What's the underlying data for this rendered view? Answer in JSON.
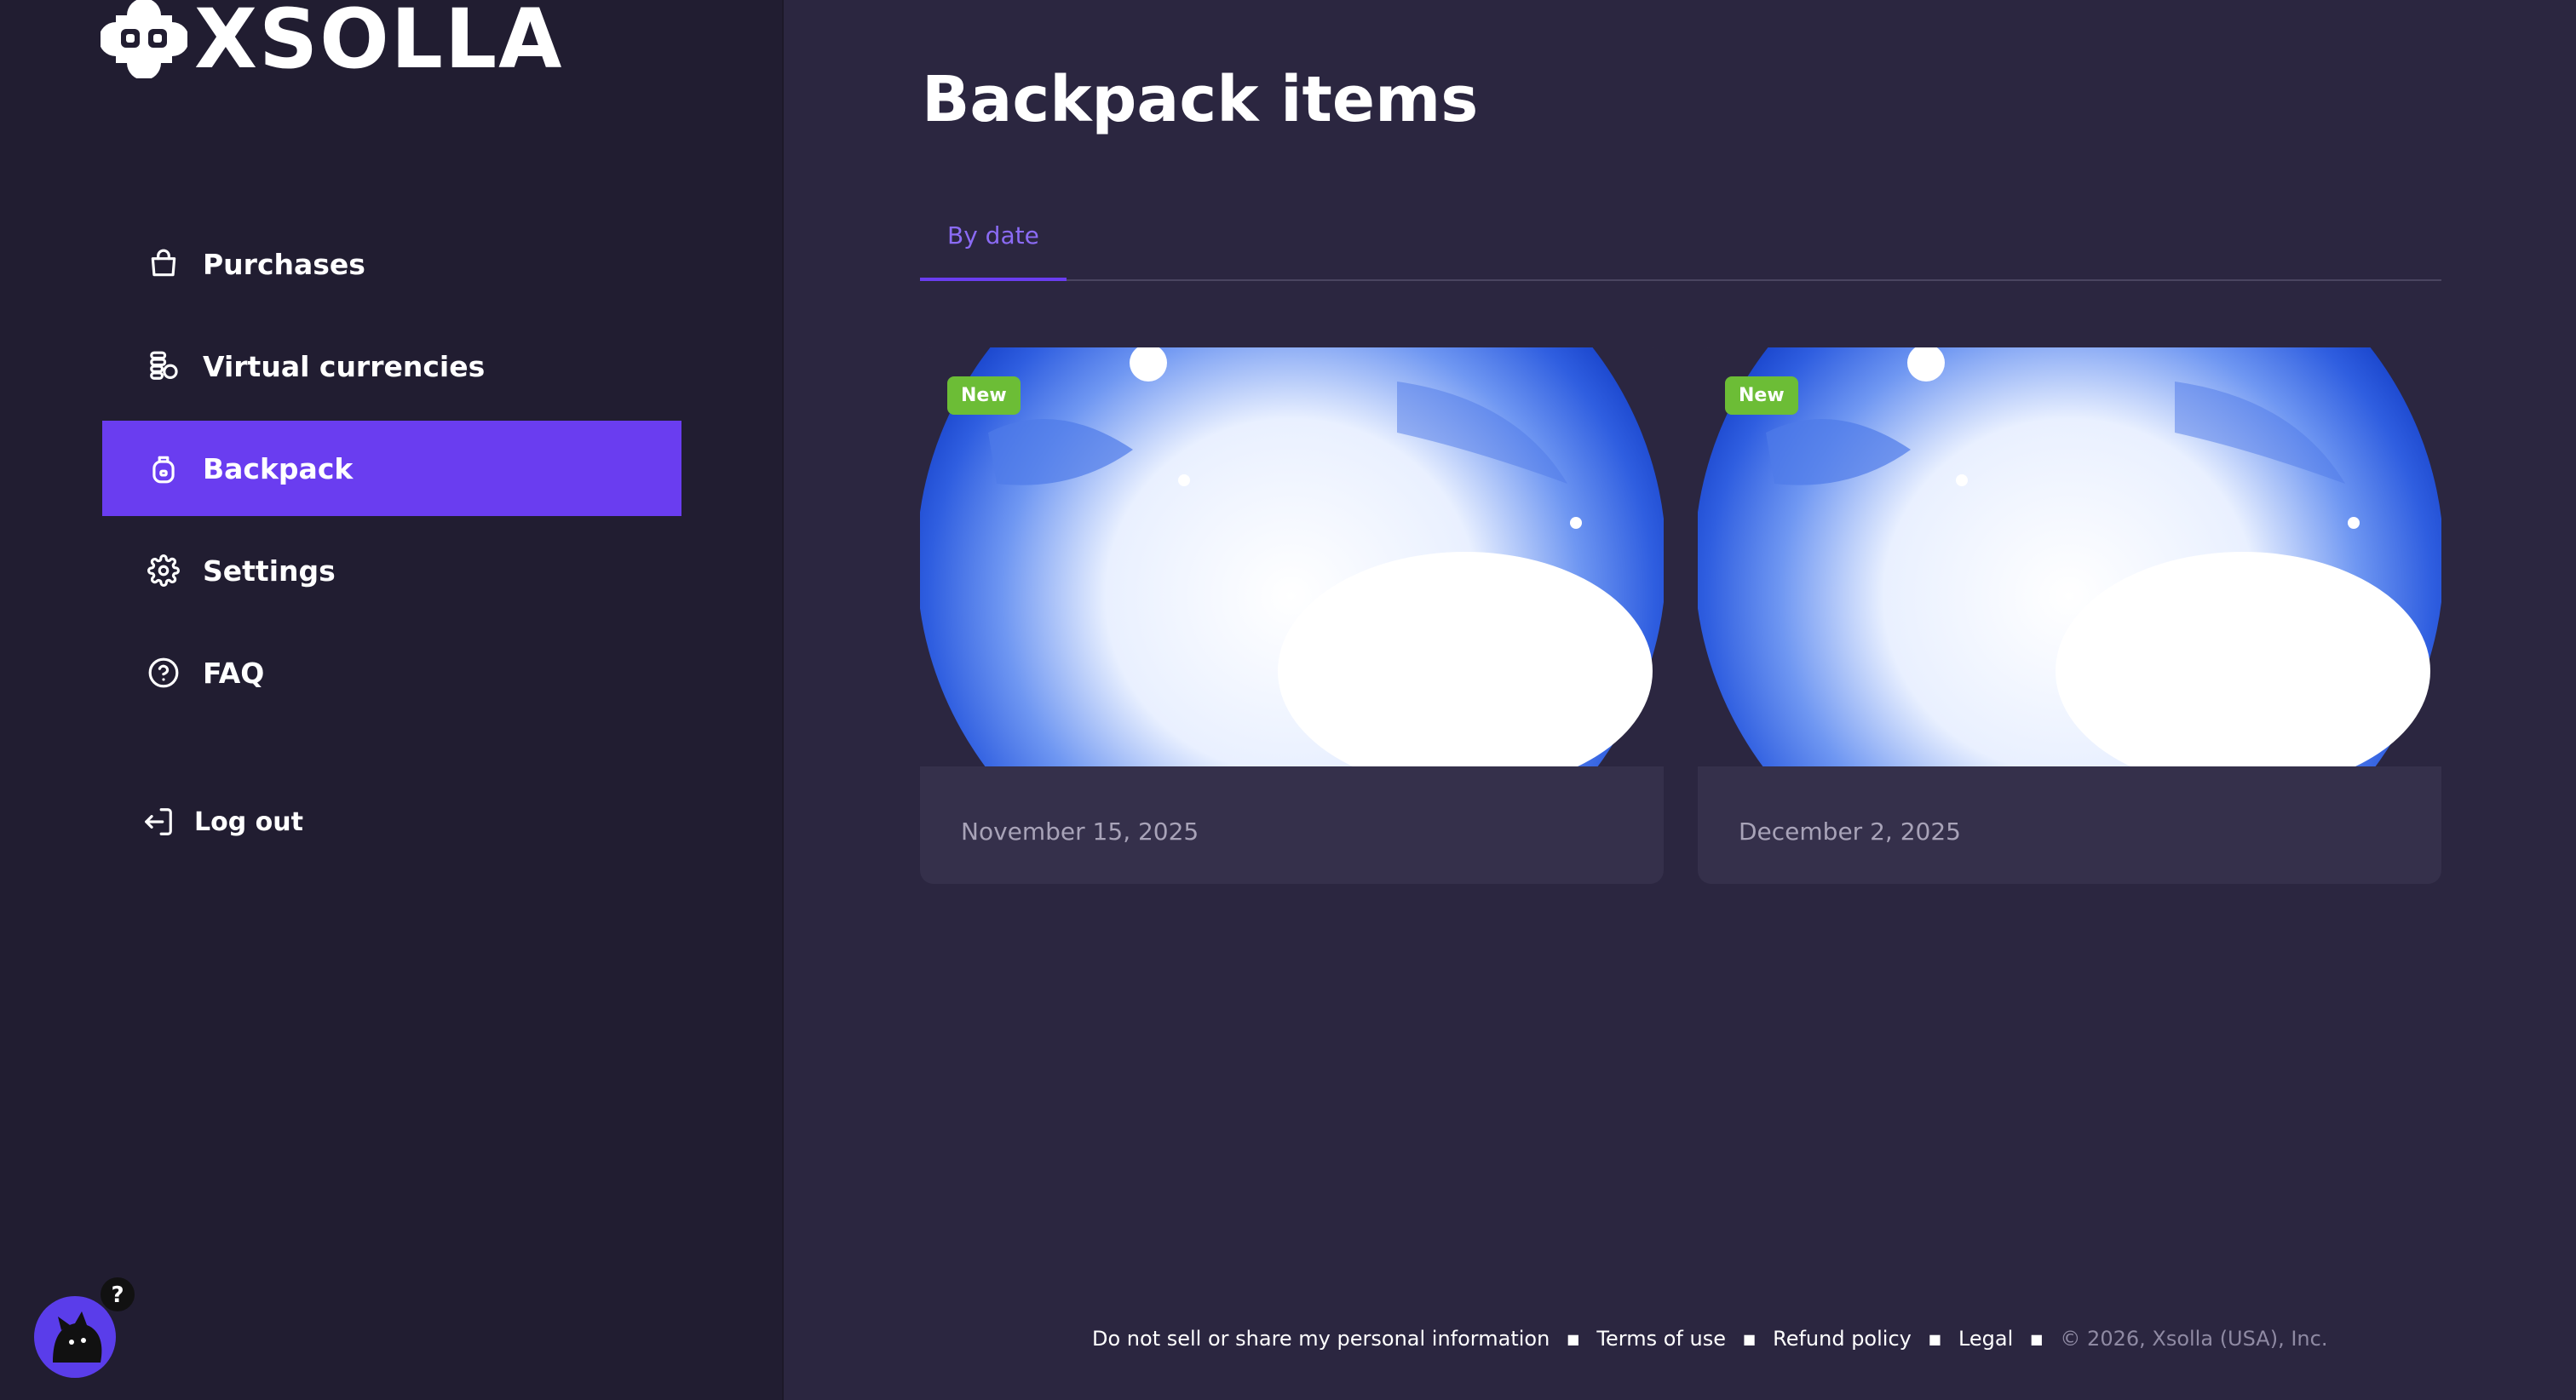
{
  "brand": {
    "name": "XSOLLA",
    "logo_icon": "xsolla-logo-icon"
  },
  "colors": {
    "sidebar_bg": "#211d31",
    "main_bg": "#2b2640",
    "accent": "#6a3df0",
    "tab_text": "#8b6bf5",
    "badge_green": "#6cbd36",
    "card_bg": "#35304b"
  },
  "sidebar": {
    "items": [
      {
        "label": "Purchases",
        "icon": "shopping-bag-icon",
        "active": false
      },
      {
        "label": "Virtual currencies",
        "icon": "coins-icon",
        "active": false
      },
      {
        "label": "Backpack",
        "icon": "backpack-icon",
        "active": true
      },
      {
        "label": "Settings",
        "icon": "gear-icon",
        "active": false
      },
      {
        "label": "FAQ",
        "icon": "question-circle-icon",
        "active": false
      }
    ],
    "logout_label": "Log out",
    "logout_icon": "logout-icon",
    "support_icon": "support-cat-icon"
  },
  "main": {
    "title": "Backpack items",
    "tabs": [
      {
        "label": "By date",
        "active": true
      }
    ],
    "cards": [
      {
        "badge": "New",
        "date": "November 15, 2025"
      },
      {
        "badge": "New",
        "date": "December 2, 2025"
      }
    ]
  },
  "footer": {
    "links": [
      "Do not sell or share my personal information",
      "Terms of use",
      "Refund policy",
      "Legal"
    ],
    "copyright": "© 2026, Xsolla (USA), Inc."
  }
}
